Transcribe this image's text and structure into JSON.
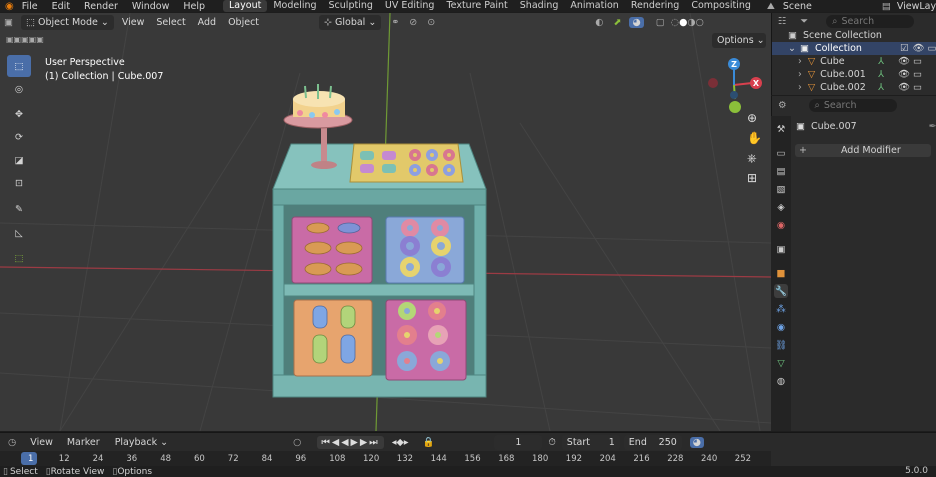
{
  "menu": {
    "file": "File",
    "edit": "Edit",
    "render": "Render",
    "window": "Window",
    "help": "Help"
  },
  "workspaces": [
    "Layout",
    "Modeling",
    "Sculpting",
    "UV Editing",
    "Texture Paint",
    "Shading",
    "Animation",
    "Rendering",
    "Compositing"
  ],
  "scene": "Scene",
  "view_layer": "ViewLayer",
  "viewport_header": {
    "mode": "Object Mode",
    "view": "View",
    "select": "Select",
    "add": "Add",
    "object": "Object",
    "orientation": "Global",
    "options": "Options"
  },
  "viewport": {
    "perspective": "User Perspective",
    "collection_label": "(1) Collection | Cube.007"
  },
  "outliner": {
    "search_placeholder": "Search",
    "scene_collection": "Scene Collection",
    "collection": "Collection",
    "items": [
      "Cube",
      "Cube.001",
      "Cube.002"
    ]
  },
  "properties": {
    "search_placeholder": "Search",
    "object_name": "Cube.007",
    "add_modifier": "Add Modifier"
  },
  "timeline": {
    "view": "View",
    "marker": "Marker",
    "playback": "Playback",
    "current_frame": "1",
    "start_label": "Start",
    "start": "1",
    "end_label": "End",
    "end": "250",
    "frames": [
      "1",
      "12",
      "24",
      "36",
      "48",
      "60",
      "72",
      "84",
      "96",
      "108",
      "120",
      "132",
      "144",
      "156",
      "168",
      "180",
      "192",
      "204",
      "216",
      "228",
      "240",
      "252"
    ]
  },
  "status": {
    "select": "Select",
    "rotate": "Rotate View",
    "options": "Options",
    "version": "5.0.0"
  },
  "colors": {
    "accent": "#4a6ea8",
    "x_axis": "#d8404e",
    "y_axis": "#8bbf3a",
    "z_axis": "#3a8bd8",
    "shelf": "#79b7b3",
    "tray_pink": "#c96ba6",
    "tray_blue": "#8aa8d8",
    "tray_orange": "#e7a46e"
  }
}
